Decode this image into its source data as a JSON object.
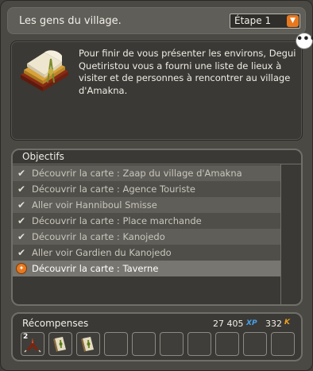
{
  "header": {
    "title": "Les gens du village.",
    "step_selected": "Étape 1"
  },
  "description": {
    "text": "Pour finir de vous présenter les environs, Degui Quetiristou vous a fourni une liste de lieux à visiter et de personnes à rencontrer au village d'Amakna."
  },
  "objectives": {
    "header": "Objectifs",
    "items": [
      {
        "label": "Découvrir la carte : Zaap du village d'Amakna",
        "done": true
      },
      {
        "label": "Découvrir la carte : Agence Touriste",
        "done": true
      },
      {
        "label": "Aller voir Hanniboul Smisse",
        "done": true
      },
      {
        "label": "Découvrir la carte : Place marchande",
        "done": true
      },
      {
        "label": "Découvrir la carte : Kanojedo",
        "done": true
      },
      {
        "label": "Aller voir Gardien du Kanojedo",
        "done": true
      },
      {
        "label": "Découvrir la carte : Taverne",
        "done": false
      }
    ]
  },
  "rewards": {
    "label": "Récompenses",
    "xp": "27 405",
    "xp_unit": "XP",
    "kamas": "332",
    "kamas_unit": "K",
    "items": [
      {
        "icon": "claw-item-icon",
        "qty": "2"
      },
      {
        "icon": "scroll-item-icon",
        "qty": ""
      },
      {
        "icon": "scroll-item-icon",
        "qty": ""
      }
    ],
    "empty_slots": 7
  },
  "colors": {
    "accent": "#e8781e",
    "xp": "#4aa0e8",
    "kamas": "#f0a020"
  }
}
